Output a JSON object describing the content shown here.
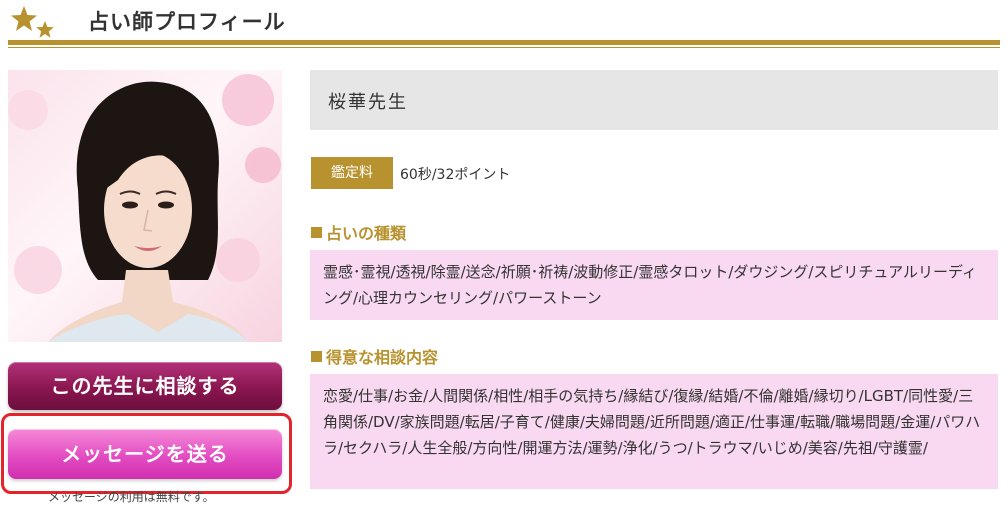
{
  "header": {
    "title": "占い師プロフィール",
    "star_icon_color": "#b8922e"
  },
  "profile": {
    "name": "桜華先生",
    "fee_label": "鑑定料",
    "fee_value": "60秒/32ポイント"
  },
  "sections": {
    "types_heading": "占いの種類",
    "types_text": "霊感･霊視/透視/除霊/送念/祈願･祈祷/波動修正/霊感タロット/ダウジング/スピリチュアルリーディング/心理カウンセリング/パワーストーン",
    "specialty_heading": "得意な相談内容",
    "specialty_text": "恋愛/仕事/お金/人間関係/相性/相手の気持ち/縁結び/復縁/結婚/不倫/離婚/縁切り/LGBT/同性愛/三角関係/DV/家族問題/転居/子育て/健康/夫婦問題/近所問題/適正/仕事運/転職/職場問題/金運/パワハラ/セクハラ/人生全般/方向性/開運方法/運勢/浄化/うつ/トラウマ/いじめ/美容/先祖/守護霊/"
  },
  "actions": {
    "consult_label": "この先生に相談する",
    "message_label": "メッセージを送る",
    "message_note": "メッセージの利用は無料です。"
  },
  "colors": {
    "accent_gold": "#b8922e",
    "consult_button": "#8a1650",
    "message_button": "#e34cc2",
    "content_box": "#f9d9f1",
    "highlight": "#e3242b"
  }
}
